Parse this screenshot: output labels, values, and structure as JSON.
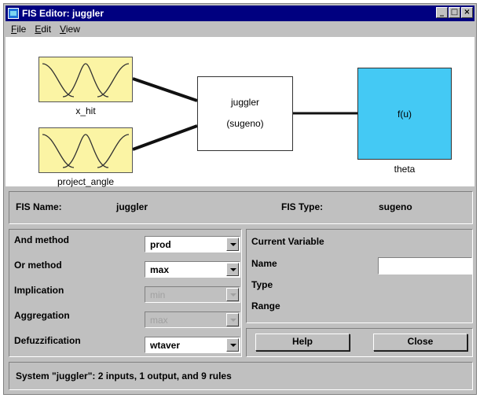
{
  "window": {
    "title": "FIS Editor: juggler"
  },
  "menu": [
    "File",
    "Edit",
    "View"
  ],
  "window_buttons": {
    "minimize": "_",
    "maximize": "□",
    "close": "×"
  },
  "diagram": {
    "inputs": [
      "x_hit",
      "project_angle"
    ],
    "system": {
      "name": "juggler",
      "type": "(sugeno)"
    },
    "output": {
      "function": "f(u)",
      "name": "theta"
    },
    "colors": {
      "input_block": "#fbf4a4",
      "output_block": "#44c9f4"
    }
  },
  "fis": {
    "name_label": "FIS Name:",
    "name_value": "juggler",
    "type_label": "FIS Type:",
    "type_value": "sugeno"
  },
  "methods": [
    {
      "label": "And method",
      "value": "prod",
      "enabled": true
    },
    {
      "label": "Or method",
      "value": "max",
      "enabled": true
    },
    {
      "label": "Implication",
      "value": "min",
      "enabled": false
    },
    {
      "label": "Aggregation",
      "value": "max",
      "enabled": false
    },
    {
      "label": "Defuzzification",
      "value": "wtaver",
      "enabled": true
    }
  ],
  "current_variable": {
    "heading": "Current Variable",
    "name_label": "Name",
    "name_value": "",
    "type_label": "Type",
    "range_label": "Range"
  },
  "buttons": {
    "help": "Help",
    "close": "Close"
  },
  "status": "System \"juggler\": 2 inputs, 1 output, and 9 rules"
}
